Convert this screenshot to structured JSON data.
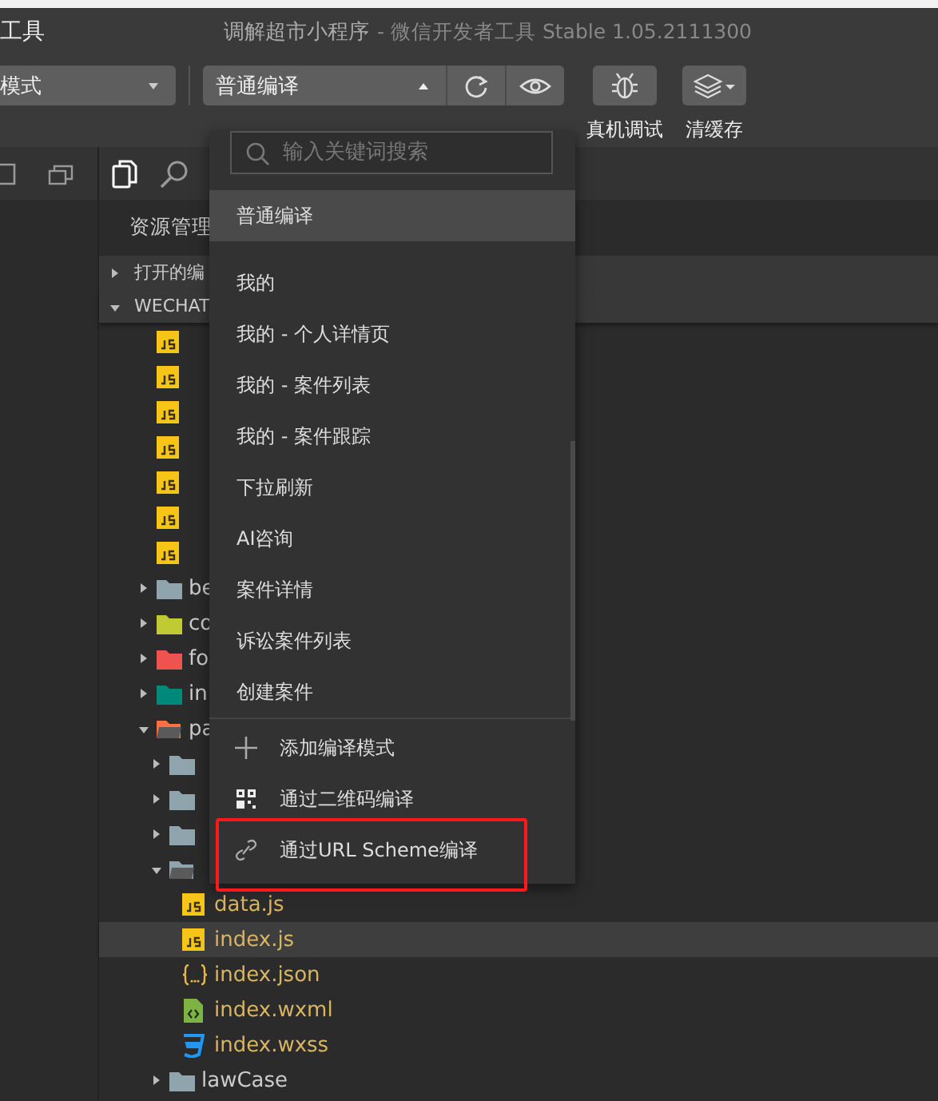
{
  "title_bar": {
    "menu_label": "工具",
    "project": "调解超市小程序",
    "app": "- 微信开发者工具 Stable 1.05.2111300"
  },
  "toolbar": {
    "mode_select": {
      "value": "模式"
    },
    "compile_select": {
      "value": "普通编译",
      "expanded": true
    },
    "buttons": [
      {
        "kind": "debug",
        "label": "真机调试"
      },
      {
        "kind": "cache",
        "label": "清缓存"
      }
    ]
  },
  "explorer": {
    "tabs": [
      {
        "kind": "files",
        "selected": true
      },
      {
        "kind": "search",
        "selected": false
      }
    ],
    "title": "资源管理",
    "sections": [
      {
        "label": "打开的编",
        "expanded": false
      },
      {
        "label": "WECHAT",
        "expanded": true
      }
    ],
    "tree": [
      {
        "kind": "js",
        "selected": false
      },
      {
        "kind": "js",
        "selected": false
      },
      {
        "kind": "js",
        "selected": false
      },
      {
        "kind": "js",
        "selected": false
      },
      {
        "kind": "js",
        "selected": false
      },
      {
        "kind": "js",
        "selected": false
      },
      {
        "kind": "js",
        "selected": false
      },
      {
        "kind": "folder",
        "name": "be",
        "color": "#90a4ae",
        "expanded": false,
        "selected": false
      },
      {
        "kind": "folder",
        "name": "co",
        "color": "#c0ca33",
        "expanded": false,
        "selected": false
      },
      {
        "kind": "folder",
        "name": "fo",
        "color": "#ef5350",
        "expanded": false,
        "selected": false
      },
      {
        "kind": "folder",
        "name": "in",
        "color": "#00897b",
        "expanded": false,
        "selected": false
      },
      {
        "kind": "folder",
        "name": "pa",
        "color": "#ff7043",
        "expanded": true,
        "selected": false,
        "children": [
          {
            "kind": "folder",
            "color": "#90a4ae",
            "expanded": false,
            "selected": false
          },
          {
            "kind": "folder",
            "color": "#90a4ae",
            "expanded": false,
            "selected": false
          },
          {
            "kind": "folder",
            "color": "#90a4ae",
            "expanded": false,
            "selected": false
          },
          {
            "kind": "folder",
            "color": "#90a4ae",
            "expanded": true,
            "selected": false,
            "children": [
              {
                "kind": "js",
                "name": "data.js",
                "selected": false
              },
              {
                "kind": "js",
                "name": "index.js",
                "selected": true
              },
              {
                "kind": "json",
                "name": "index.json",
                "selected": false
              },
              {
                "kind": "wxml",
                "name": "index.wxml",
                "selected": false
              },
              {
                "kind": "wxss",
                "name": "index.wxss",
                "selected": false
              }
            ]
          },
          {
            "kind": "folder",
            "name": "lawCase",
            "color": "#90a4ae",
            "expanded": false,
            "selected": false
          }
        ]
      }
    ]
  },
  "compile_menu": {
    "search": {
      "placeholder": "输入关键词搜索"
    },
    "current": "普通编译",
    "modes": [
      {
        "label": "我的",
        "selected": false
      },
      {
        "label": "我的 - 个人详情页",
        "selected": false
      },
      {
        "label": "我的 - 案件列表",
        "selected": false
      },
      {
        "label": "我的 - 案件跟踪",
        "selected": false
      },
      {
        "label": "下拉刷新",
        "selected": false
      },
      {
        "label": "AI咨询",
        "selected": false
      },
      {
        "label": "案件详情",
        "selected": false
      },
      {
        "label": "诉讼案件列表",
        "selected": false
      },
      {
        "label": "创建案件",
        "selected": false
      }
    ],
    "actions": [
      {
        "kind": "add",
        "label": "添加编译模式",
        "annotated": false
      },
      {
        "kind": "qrcode",
        "label": "通过二维码编译",
        "annotated": false
      },
      {
        "kind": "link",
        "label": "通过URL Scheme编译",
        "annotated": true
      }
    ]
  }
}
